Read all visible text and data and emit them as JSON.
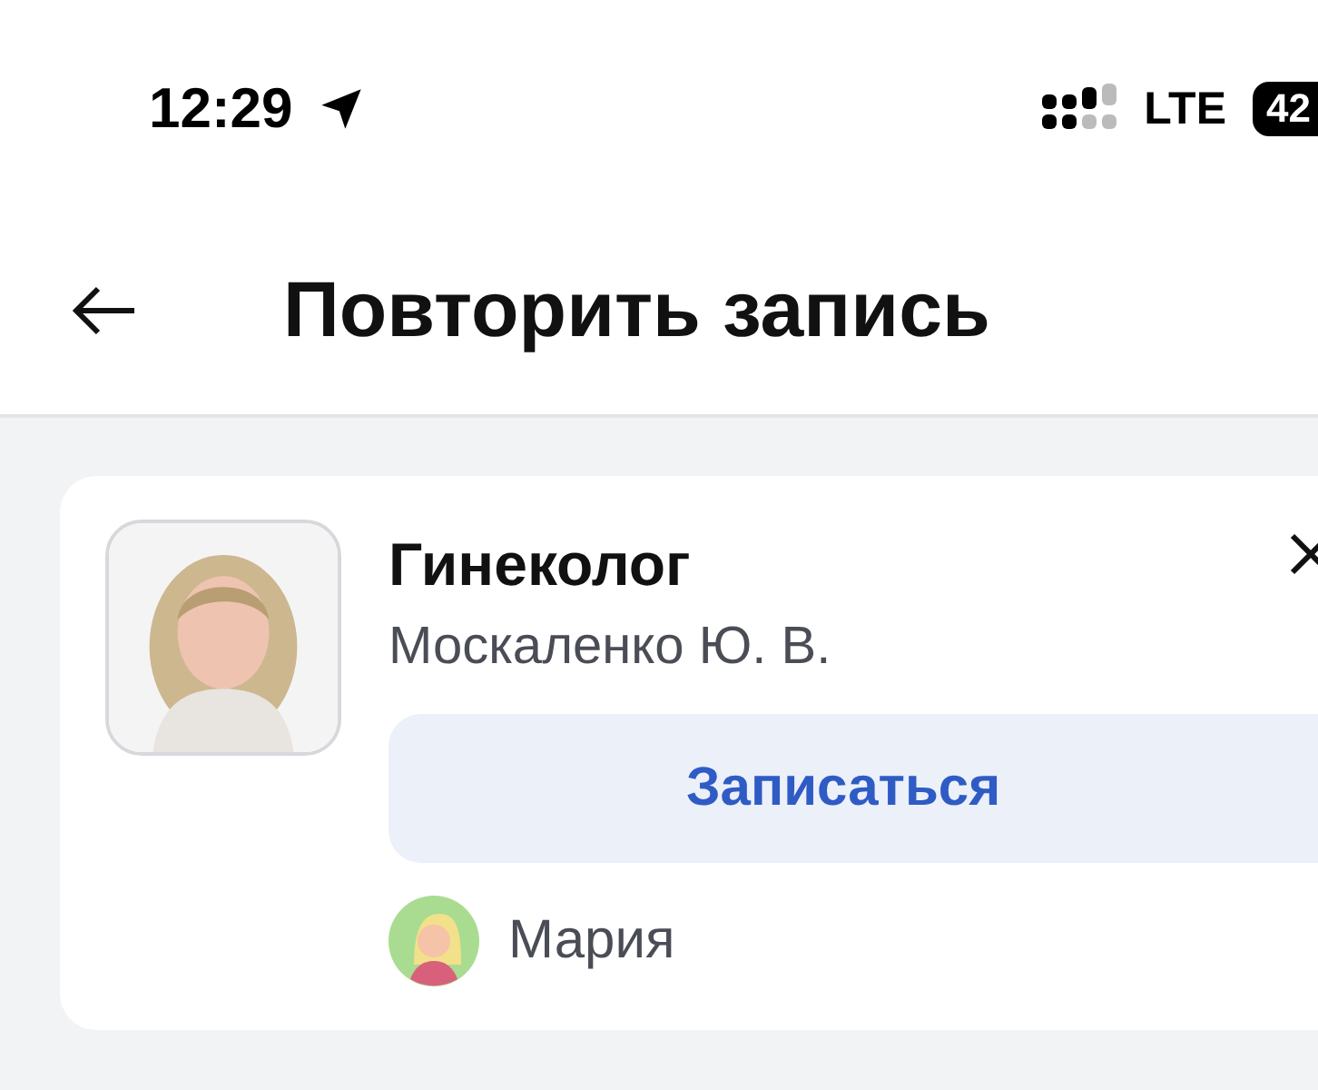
{
  "status_bar": {
    "time": "12:29",
    "network": "LTE",
    "battery": "42"
  },
  "header": {
    "title": "Повторить запись"
  },
  "appointment": {
    "specialty": "Гинеколог",
    "doctor": "Москаленко Ю. В.",
    "action": "Записаться",
    "patient": "Мария"
  }
}
